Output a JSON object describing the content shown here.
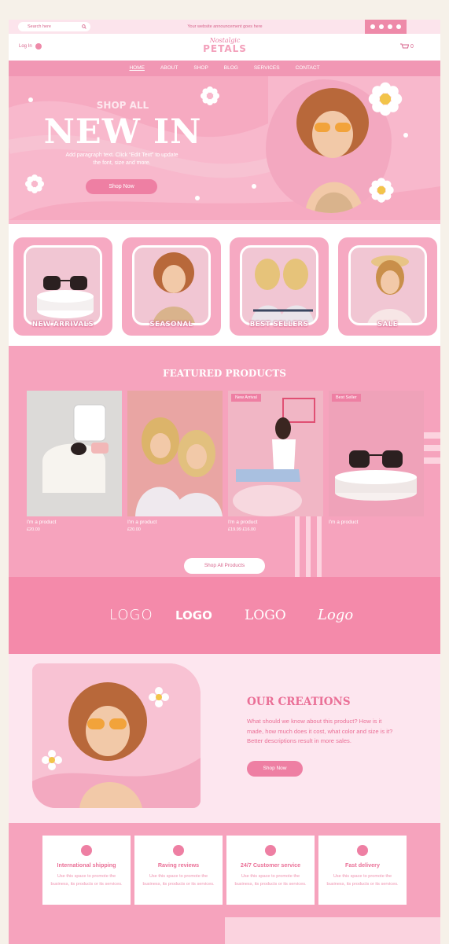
{
  "topbar": {
    "search_placeholder": "Search here",
    "announcement": "Your website announcement goes here",
    "social_icons": [
      "instagram-icon",
      "facebook-icon",
      "youtube-icon",
      "tiktok-icon"
    ]
  },
  "header": {
    "login": "Log In",
    "logo_script": "Nostalgic",
    "logo_main": "PETALS",
    "cart_count": "0"
  },
  "nav": {
    "items": [
      "HOME",
      "ABOUT",
      "SHOP",
      "BLOG",
      "SERVICES",
      "CONTACT"
    ]
  },
  "hero": {
    "kicker": "SHOP ALL",
    "title": "NEW IN",
    "description": "Add paragraph text. Click “Edit Text” to update the font, size and more.",
    "button": "Shop Now"
  },
  "categories": [
    "NEW ARRIVALS",
    "SEASONAL",
    "BEST SELLERS",
    "SALE"
  ],
  "featured": {
    "title": "FEATURED PRODUCTS",
    "products": [
      {
        "name": "I'm a product",
        "price": "£20.00",
        "badge": ""
      },
      {
        "name": "I'm a product",
        "price": "£20.00",
        "badge": ""
      },
      {
        "name": "I'm a product",
        "price": "£19.99 £16.00",
        "badge": "New Arrival"
      },
      {
        "name": "I'm a product",
        "price": "",
        "badge": "Best Seller"
      }
    ],
    "button": "Shop All Products"
  },
  "logos": [
    "LOGO",
    "LOGO",
    "LOGO",
    "Logo"
  ],
  "creations": {
    "title": "OUR CREATIONS",
    "text": "What should we know about this product? How is it made, how much does it cost, what color and size is it? Better descriptions result in more sales.",
    "button": "Shop Now"
  },
  "features": [
    {
      "title": "International shipping",
      "text": "Use this space to promote the business, its products or its services.",
      "icon": "globe-icon"
    },
    {
      "title": "Raving reviews",
      "text": "Use this space to promote the business, its products or its services.",
      "icon": "star-icon"
    },
    {
      "title": "24/7 Customer service",
      "text": "Use this space to promote the business, its products or its services.",
      "icon": "smiley-icon"
    },
    {
      "title": "Fast delivery",
      "text": "Use this space to promote the business, its products or its services.",
      "icon": "airplane-icon"
    }
  ],
  "colors": {
    "accent": "#ee7fa3",
    "pink_light": "#fde6ef",
    "pink_mid": "#f6a3bd",
    "text_pink": "#ea6f96"
  }
}
